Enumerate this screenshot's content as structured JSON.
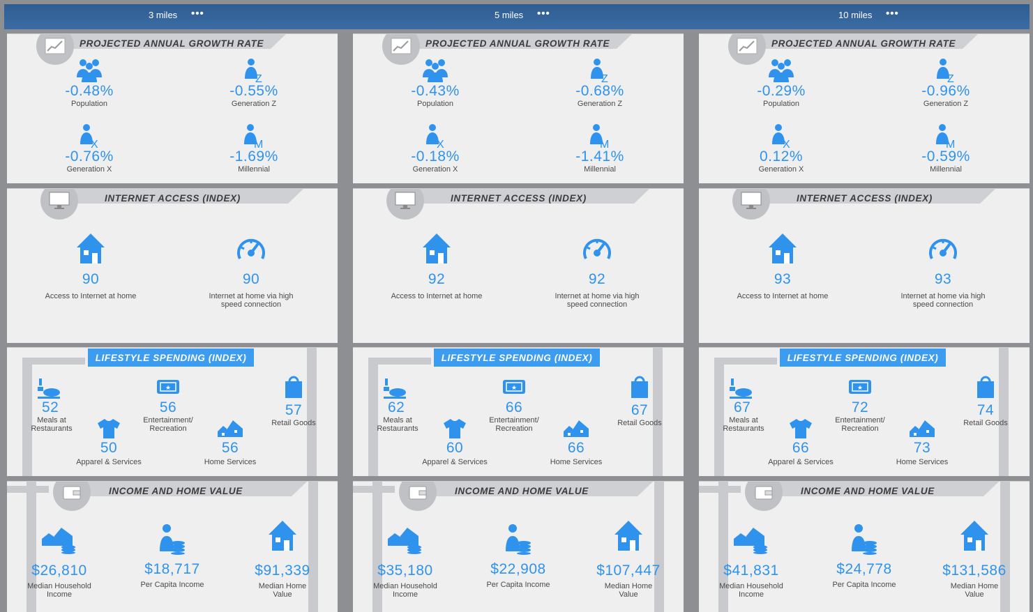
{
  "colors": {
    "accent": "#2f93ee",
    "header_bar": "#2f5d92",
    "panel_bg": "#efefef",
    "banner_gray": "#cfd0d3",
    "banner_blue": "#3b9cf0"
  },
  "headings": {
    "growth": "PROJECTED ANNUAL GROWTH RATE",
    "internet": "INTERNET ACCESS (INDEX)",
    "lifestyle": "LIFESTYLE SPENDING (INDEX)",
    "income": "INCOME AND HOME VALUE"
  },
  "labels": {
    "population": "Population",
    "genz": "Generation Z",
    "genx": "Generation X",
    "millennial": "Millennial",
    "access_home": "Access to Internet at home",
    "high_speed_1": "Internet at home via high",
    "high_speed_2": "speed connection",
    "meals_1": "Meals at",
    "meals_2": "Restaurants",
    "entertainment_1": "Entertainment/",
    "entertainment_2": "Recreation",
    "retail": "Retail Goods",
    "apparel": "Apparel & Services",
    "home_services": "Home Services",
    "mhi_1": "Median Household",
    "mhi_2": "Income",
    "per_capita": "Per Capita Income",
    "mhv_1": "Median Home",
    "mhv_2": "Value",
    "menu_dots": "•••"
  },
  "icons": {
    "growth": "line-chart-icon",
    "internet": "monitor-icon",
    "income": "wallet-icon",
    "population": "people-icon",
    "genz": "person-z-icon",
    "genx": "person-x-icon",
    "millennial": "person-m-icon",
    "home": "house-icon",
    "speed": "speedometer-icon",
    "meals": "dining-icon",
    "entertainment": "ticket-icon",
    "retail": "shopping-bag-icon",
    "apparel": "tshirt-icon",
    "home_services": "houses-icon",
    "income_households": "houses-coins-icon",
    "per_capita": "person-coins-icon",
    "home_value": "house-icon"
  },
  "columns": [
    {
      "radius": "3 miles",
      "growth": {
        "population": "-0.48%",
        "genz": "-0.55%",
        "genx": "-0.76%",
        "millennial": "-1.69%"
      },
      "internet": {
        "access": "90",
        "high_speed": "90"
      },
      "lifestyle": {
        "meals": "52",
        "entertainment": "56",
        "retail": "57",
        "apparel": "50",
        "home_services": "56"
      },
      "income": {
        "median_household": "$26,810",
        "per_capita": "$18,717",
        "median_home": "$91,339"
      }
    },
    {
      "radius": "5 miles",
      "growth": {
        "population": "-0.43%",
        "genz": "-0.68%",
        "genx": "-0.18%",
        "millennial": "-1.41%"
      },
      "internet": {
        "access": "92",
        "high_speed": "92"
      },
      "lifestyle": {
        "meals": "62",
        "entertainment": "66",
        "retail": "67",
        "apparel": "60",
        "home_services": "66"
      },
      "income": {
        "median_household": "$35,180",
        "per_capita": "$22,908",
        "median_home": "$107,447"
      }
    },
    {
      "radius": "10 miles",
      "growth": {
        "population": "-0.29%",
        "genz": "-0.96%",
        "genx": "0.12%",
        "millennial": "-0.59%"
      },
      "internet": {
        "access": "93",
        "high_speed": "93"
      },
      "lifestyle": {
        "meals": "67",
        "entertainment": "72",
        "retail": "74",
        "apparel": "66",
        "home_services": "73"
      },
      "income": {
        "median_household": "$41,831",
        "per_capita": "$24,778",
        "median_home": "$131,586"
      }
    }
  ]
}
